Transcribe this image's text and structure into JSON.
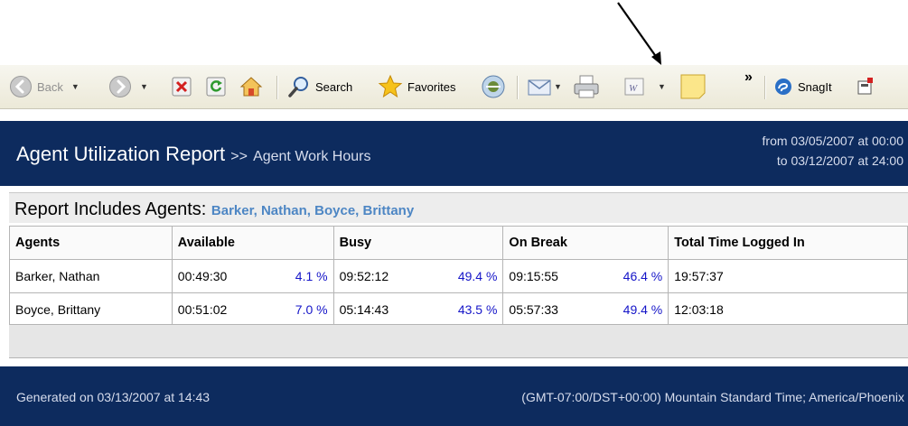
{
  "toolbar": {
    "back_label": "Back",
    "search_label": "Search",
    "favorites_label": "Favorites",
    "overflow_label": "»",
    "snagit_label": "SnagIt"
  },
  "report": {
    "title": "Agent Utilization Report",
    "separator": ">>",
    "subtitle": "Agent Work Hours",
    "date_from": "from 03/05/2007 at 00:00",
    "date_to": "to 03/12/2007 at 24:00",
    "includes_label": "Report Includes Agents:",
    "includes_names": "Barker, Nathan, Boyce, Brittany"
  },
  "table": {
    "headers": [
      "Agents",
      "Available",
      "Busy",
      "On Break",
      "Total Time Logged In"
    ],
    "rows": [
      {
        "agent": "Barker, Nathan",
        "available": "00:49:30",
        "available_pct": "4.1 %",
        "busy": "09:52:12",
        "busy_pct": "49.4 %",
        "break": "09:15:55",
        "break_pct": "46.4 %",
        "total": "19:57:37"
      },
      {
        "agent": "Boyce, Brittany",
        "available": "00:51:02",
        "available_pct": "7.0 %",
        "busy": "05:14:43",
        "busy_pct": "43.5 %",
        "break": "05:57:33",
        "break_pct": "49.4 %",
        "total": "12:03:18"
      }
    ]
  },
  "footer": {
    "generated": "Generated on 03/13/2007 at 14:43",
    "timezone": "(GMT-07:00/DST+00:00) Mountain Standard Time; America/Phoenix"
  },
  "colors": {
    "header_bg": "#0d2b5e",
    "percent_text": "#1515c8",
    "agent_names": "#4d86c4"
  }
}
